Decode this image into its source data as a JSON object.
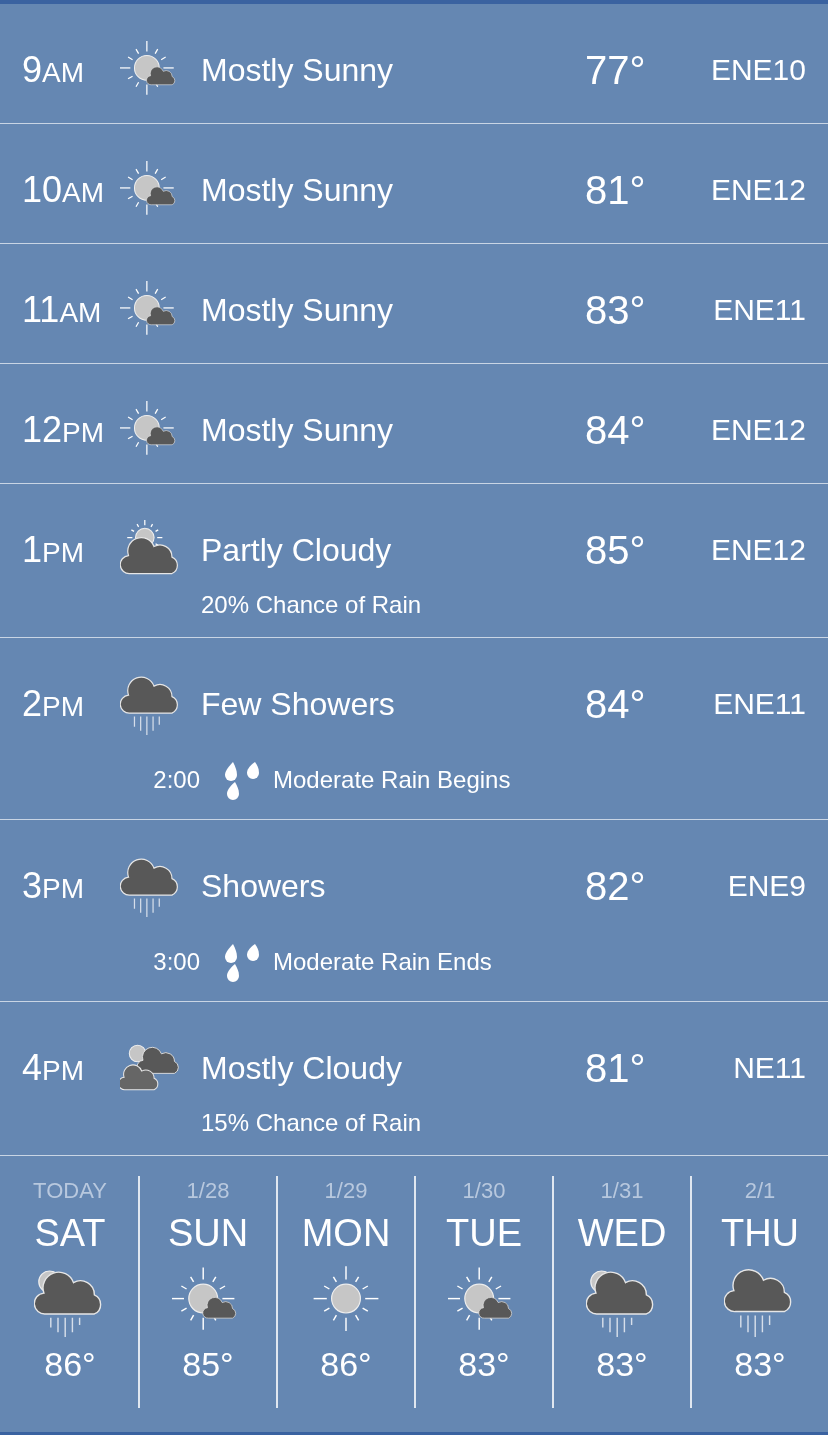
{
  "hours": [
    {
      "hour": "9",
      "period": "AM",
      "kind": "mostly-sunny",
      "condition": "Mostly Sunny",
      "temp": "77°",
      "wind": "ENE10"
    },
    {
      "hour": "10",
      "period": "AM",
      "kind": "mostly-sunny",
      "condition": "Mostly Sunny",
      "temp": "81°",
      "wind": "ENE12"
    },
    {
      "hour": "11",
      "period": "AM",
      "kind": "mostly-sunny",
      "condition": "Mostly Sunny",
      "temp": "83°",
      "wind": "ENE11"
    },
    {
      "hour": "12",
      "period": "PM",
      "kind": "mostly-sunny",
      "condition": "Mostly Sunny",
      "temp": "84°",
      "wind": "ENE12"
    },
    {
      "hour": "1",
      "period": "PM",
      "kind": "partly-cloudy",
      "condition": "Partly Cloudy",
      "temp": "85°",
      "wind": "ENE12",
      "note": {
        "kind": "chance",
        "text": "20% Chance of Rain"
      }
    },
    {
      "hour": "2",
      "period": "PM",
      "kind": "showers",
      "condition": "Few Showers",
      "temp": "84°",
      "wind": "ENE11",
      "note": {
        "kind": "event",
        "time": "2:00",
        "text": "Moderate Rain Begins"
      }
    },
    {
      "hour": "3",
      "period": "PM",
      "kind": "showers",
      "condition": "Showers",
      "temp": "82°",
      "wind": "ENE9",
      "note": {
        "kind": "event",
        "time": "3:00",
        "text": "Moderate Rain Ends"
      }
    },
    {
      "hour": "4",
      "period": "PM",
      "kind": "mostly-cloudy",
      "condition": "Mostly Cloudy",
      "temp": "81°",
      "wind": "NE11",
      "note": {
        "kind": "chance",
        "text": "15% Chance of Rain"
      }
    }
  ],
  "days": [
    {
      "date": "TODAY",
      "day": "SAT",
      "kind": "rain-sun",
      "temp": "86°"
    },
    {
      "date": "1/28",
      "day": "SUN",
      "kind": "mostly-sunny",
      "temp": "85°"
    },
    {
      "date": "1/29",
      "day": "MON",
      "kind": "sunny",
      "temp": "86°"
    },
    {
      "date": "1/30",
      "day": "TUE",
      "kind": "mostly-sunny",
      "temp": "83°"
    },
    {
      "date": "1/31",
      "day": "WED",
      "kind": "rain-sun",
      "temp": "83°"
    },
    {
      "date": "2/1",
      "day": "THU",
      "kind": "rain",
      "temp": "83°"
    }
  ]
}
